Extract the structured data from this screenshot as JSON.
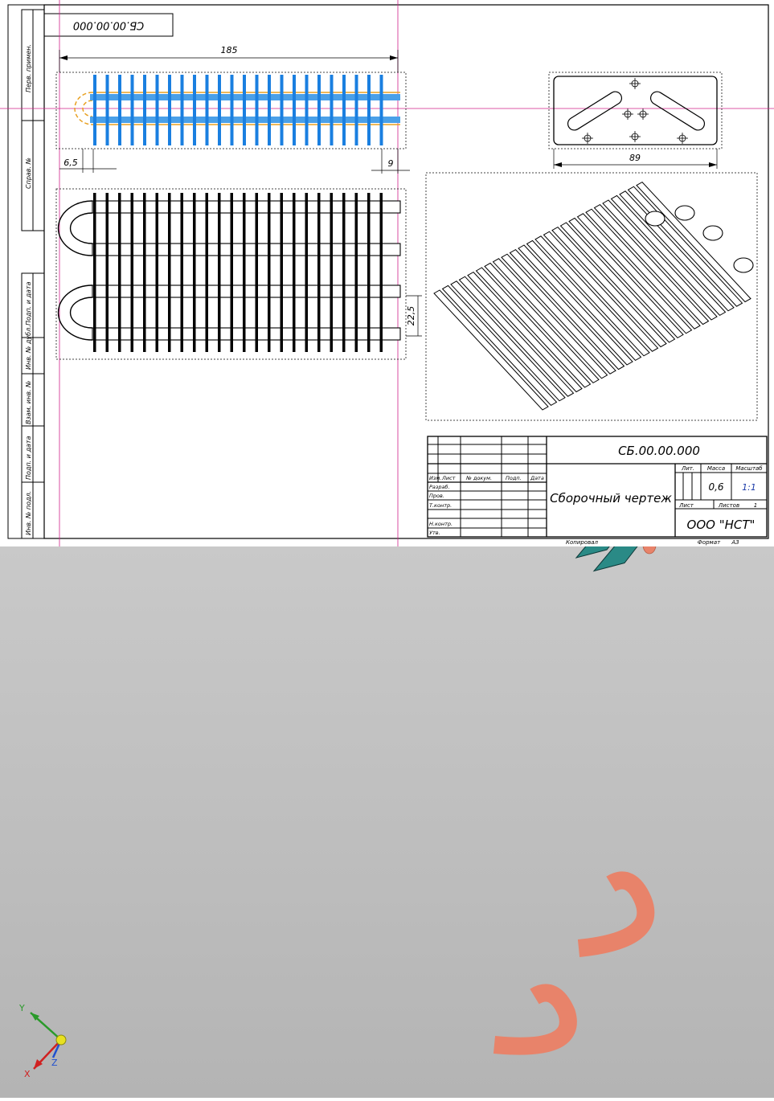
{
  "drawing": {
    "designation_rotated": "СБ.00.00.000",
    "dims": {
      "overall_length": "185",
      "left_offset": "6,5",
      "right_offset": "9",
      "flange_width": "89",
      "pitch": "22,5"
    },
    "side_labels": [
      "Перв. примен.",
      "Справ. №",
      "Подп. и дата",
      "Инв. № дубл.",
      "Взам. инв. №",
      "Подп. и дата",
      "Инв. № подл."
    ],
    "title_block": {
      "designation": "СБ.00.00.000",
      "name": "Сборочный чертеж",
      "org": "ООО \"НСТ\"",
      "lit_label": "Лит.",
      "mass_label": "Масса",
      "scale_label": "Масштаб",
      "mass": "0,6",
      "scale": "1:1",
      "sheet_label": "Лист",
      "sheets_label": "Листов",
      "sheets": "1",
      "col_headers": [
        "Изм.",
        "Лист",
        "№ докум.",
        "Подп.",
        "Дата"
      ],
      "roles": [
        "Разраб.",
        "Пров.",
        "Т.контр.",
        "Н.контр.",
        "Утв."
      ],
      "copied": "Копировал",
      "format": "Формат",
      "format_value": "А3"
    }
  },
  "viewport": {
    "axes": {
      "x": "X",
      "y": "Y",
      "z": "Z"
    },
    "colors": {
      "fin": "#2a8a86",
      "fin_edge": "#0f3b3a",
      "tube": "#e8836a",
      "bg": "#c2c2c2"
    }
  }
}
